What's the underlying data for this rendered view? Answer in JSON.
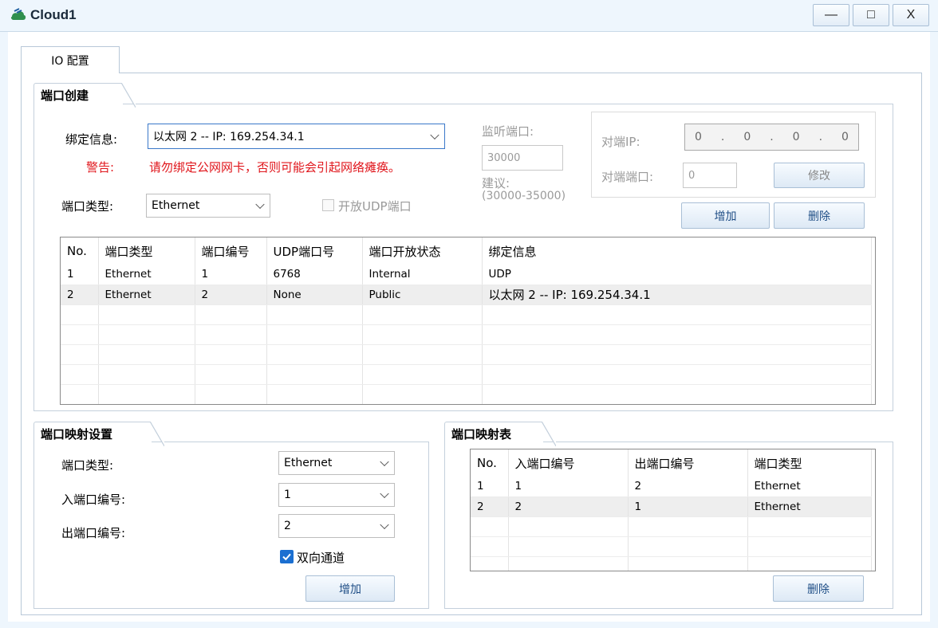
{
  "window": {
    "title": "Cloud1",
    "minimize": "—",
    "maximize": "□",
    "close": "X"
  },
  "tab": {
    "label": "IO 配置"
  },
  "port_create": {
    "title": "端口创建",
    "bind_label": "绑定信息:",
    "bind_value": "以太网 2 -- IP: 169.254.34.1",
    "warning_label": "警告:",
    "warning_text": "请勿绑定公网网卡，否则可能会引起网络瘫痪。",
    "port_type_label": "端口类型:",
    "port_type_value": "Ethernet",
    "udp_checkbox_label": "开放UDP端口",
    "listen_label": "监听端口:",
    "listen_value": "30000",
    "suggest_label": "建议:",
    "suggest_range": "(30000-35000)",
    "peer_ip_label": "对端IP:",
    "peer_ip_octets": [
      "0",
      "0",
      "0",
      "0"
    ],
    "peer_port_label": "对端端口:",
    "peer_port_value": "0",
    "modify_button": "修改",
    "add_button": "增加",
    "delete_button": "删除"
  },
  "port_table": {
    "headers": [
      "No.",
      "端口类型",
      "端口编号",
      "UDP端口号",
      "端口开放状态",
      "绑定信息"
    ],
    "rows": [
      [
        "1",
        "Ethernet",
        "1",
        "6768",
        "Internal",
        "UDP"
      ],
      [
        "2",
        "Ethernet",
        "2",
        "None",
        "Public",
        "以太网 2 -- IP: 169.254.34.1"
      ]
    ]
  },
  "map_settings": {
    "title": "端口映射设置",
    "port_type_label": "端口类型:",
    "port_type_value": "Ethernet",
    "in_port_label": "入端口编号:",
    "in_port_value": "1",
    "out_port_label": "出端口编号:",
    "out_port_value": "2",
    "bidirectional_label": "双向通道",
    "bidirectional_checked": true,
    "add_button": "增加"
  },
  "map_table": {
    "title": "端口映射表",
    "headers": [
      "No.",
      "入端口编号",
      "出端口编号",
      "端口类型"
    ],
    "rows": [
      [
        "1",
        "1",
        "2",
        "Ethernet"
      ],
      [
        "2",
        "2",
        "1",
        "Ethernet"
      ]
    ],
    "delete_button": "删除"
  }
}
